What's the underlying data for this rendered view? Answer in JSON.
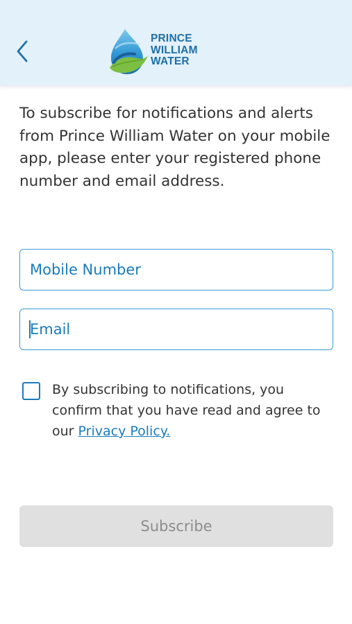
{
  "header": {
    "back_icon": "chevron-left-icon",
    "logo": {
      "line1": "PRINCE",
      "line2": "WILLIAM",
      "line3": "WATER"
    }
  },
  "intro_text": "To subscribe for notifications and alerts from Prince William Water on your mobile app, please enter your registered phone number and email address.",
  "form": {
    "mobile_placeholder": "Mobile Number",
    "email_placeholder": "Email",
    "consent_text": "By subscribing to notifications, you confirm that you have read and agree to our",
    "privacy_link": "Privacy Policy.",
    "subscribe_label": "Subscribe"
  },
  "colors": {
    "header_bg": "#e3f1fa",
    "accent": "#1a7bbd",
    "button_disabled_bg": "#e0e0e0",
    "button_disabled_text": "#8c8c8c"
  }
}
